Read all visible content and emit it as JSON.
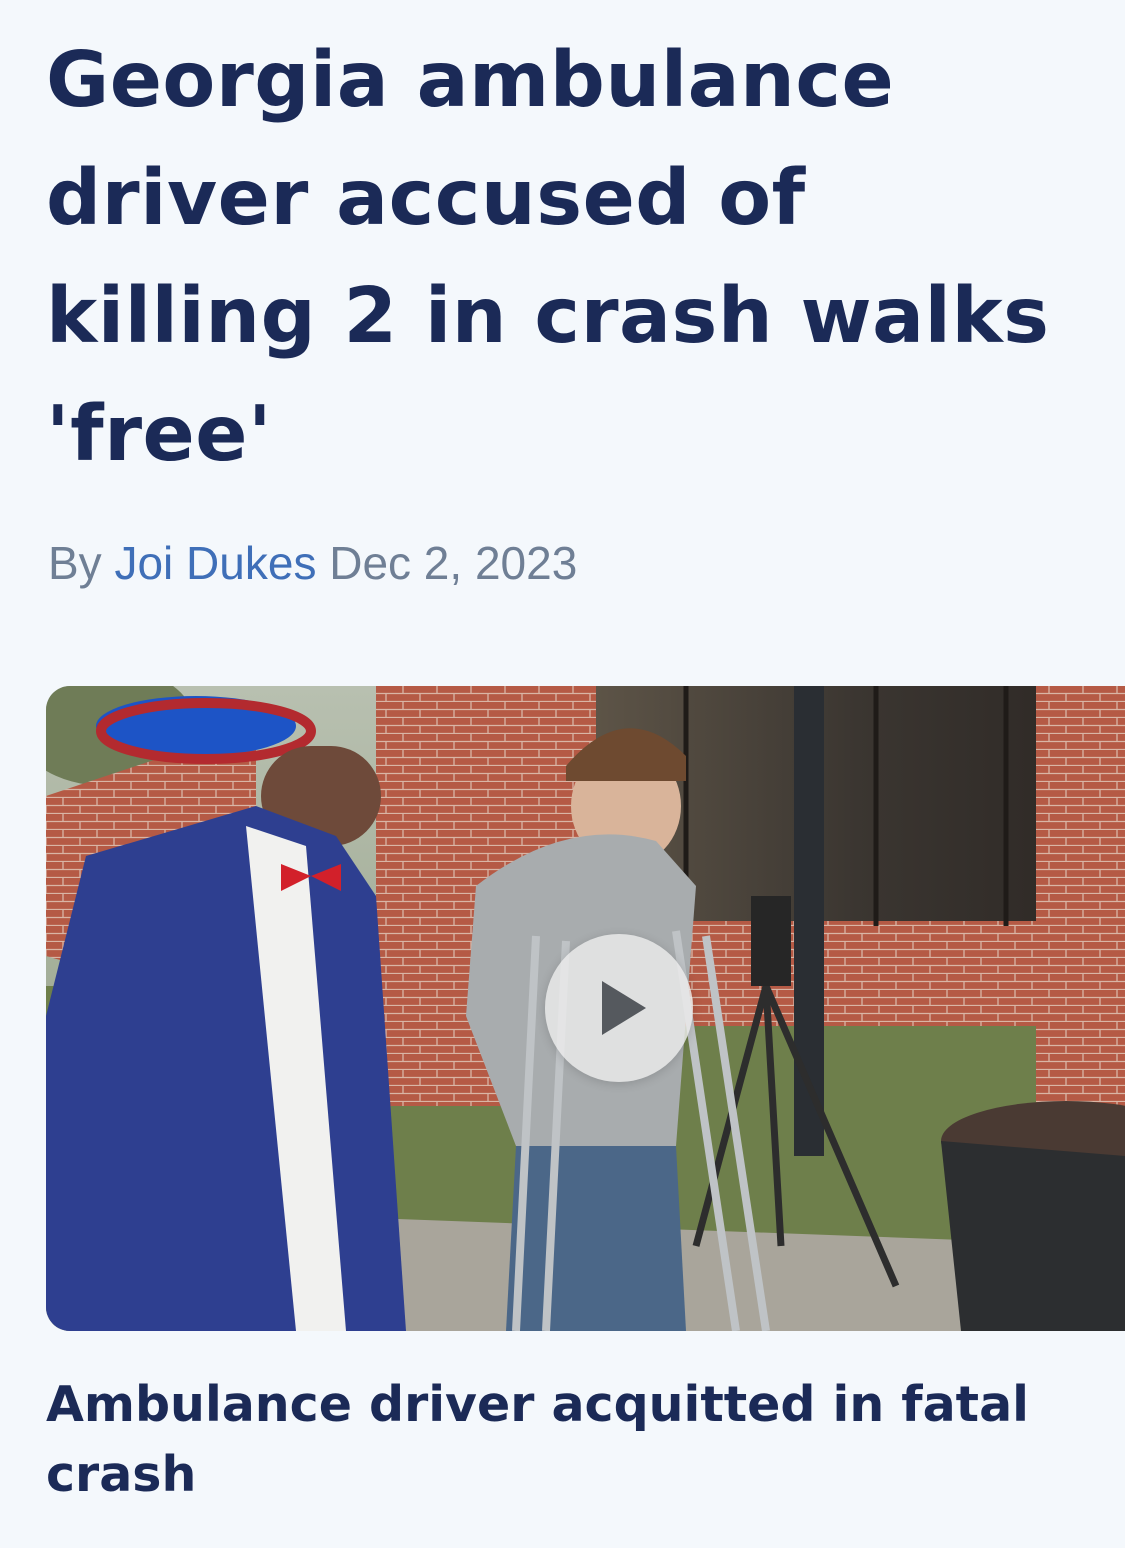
{
  "article": {
    "headline": "Georgia ambulance driver accused of killing 2 in crash walks 'free'",
    "byline": {
      "prefix": "By",
      "author": "Joi Dukes",
      "date": "Dec 2, 2023"
    },
    "video": {
      "thumbnail_alt": "Man in blue hat and suit walks beside young man on crutches outside brick building",
      "play_icon": "play-icon"
    },
    "caption": "Ambulance driver acquitted in fatal crash"
  },
  "colors": {
    "headline": "#1b2a57",
    "byline_text": "#6f7f95",
    "author_link": "#3f6fb8",
    "background": "#f4f8fc"
  }
}
